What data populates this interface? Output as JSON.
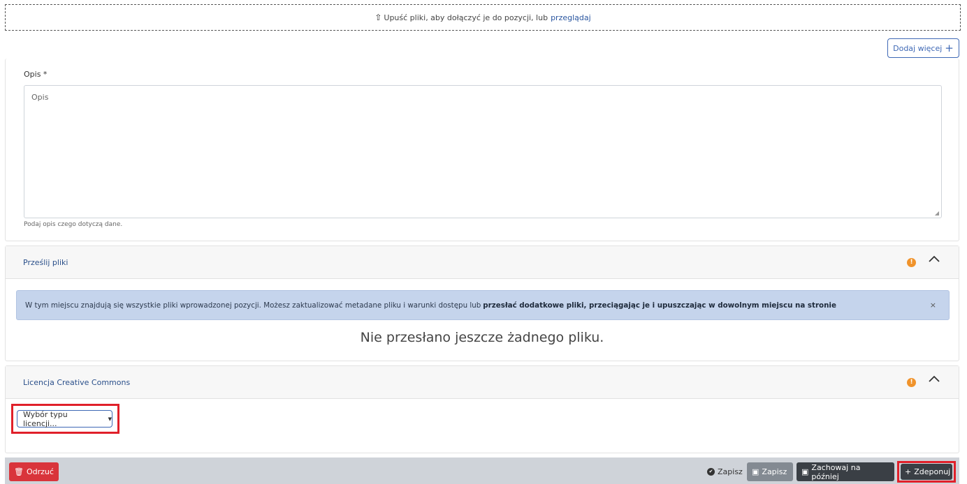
{
  "dropzone": {
    "text": "Upuść pliki, aby dołączyć je do pozycji, lub",
    "browse": "przeglądaj"
  },
  "add_more_label": "Dodaj więcej",
  "description": {
    "label": "Opis *",
    "placeholder": "Opis",
    "help": "Podaj opis czego dotyczą dane."
  },
  "files_section": {
    "title": "Prześlij pliki",
    "info_text": "W tym miejscu znajdują się wszystkie pliki wprowadzonej pozycji. Możesz zaktualizować metadane pliku i warunki dostępu lub",
    "info_bold": "przesłać dodatkowe pliki, przeciągając je i upuszczając w dowolnym miejscu na stronie",
    "close_label": "×",
    "empty_text": "Nie przesłano jeszcze żadnego pliku."
  },
  "license_section": {
    "title": "Licencja Creative Commons",
    "select_label": "Wybór typu licencji..."
  },
  "footer": {
    "discard_label": "Odrzuć",
    "saved_text": "Zapisz",
    "save_label": "Zapisz",
    "save_later_label": "Zachowaj na później",
    "deposit_label": "Zdeponuj"
  },
  "colors": {
    "accent": "#3e68b5",
    "danger": "#d9343b",
    "warning": "#f0932b",
    "highlight": "#e0202a"
  }
}
